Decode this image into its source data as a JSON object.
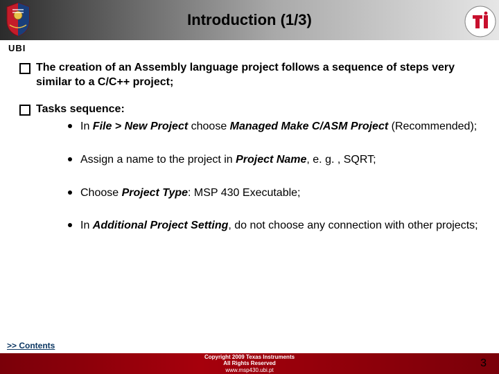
{
  "header": {
    "title": "Introduction (1/3)",
    "ubi_label": "UBI"
  },
  "content": {
    "item1": {
      "line": "The creation of an Assembly language project follows a sequence of steps very similar to a C/C++ project;"
    },
    "item2": {
      "heading": "Tasks sequence:",
      "sub1_a": "In ",
      "sub1_b": "File > New Project",
      "sub1_c": " choose ",
      "sub1_d": "Managed Make C/ASM Project",
      "sub1_e": " (Recommended);",
      "sub2_a": "Assign a name to the project in ",
      "sub2_b": "Project Name",
      "sub2_c": ", e. g. , SQRT;",
      "sub3_a": "Choose ",
      "sub3_b": "Project Type",
      "sub3_c": ": MSP 430 Executable;",
      "sub4_a": "In ",
      "sub4_b": "Additional Project Setting",
      "sub4_c": ", do not choose any connection with other projects;"
    }
  },
  "nav": {
    "contents": ">> Contents"
  },
  "footer": {
    "copyright": "Copyright  2009 Texas Instruments",
    "rights": "All Rights Reserved",
    "url": "www.msp430.ubi.pt"
  },
  "page_number": "3"
}
